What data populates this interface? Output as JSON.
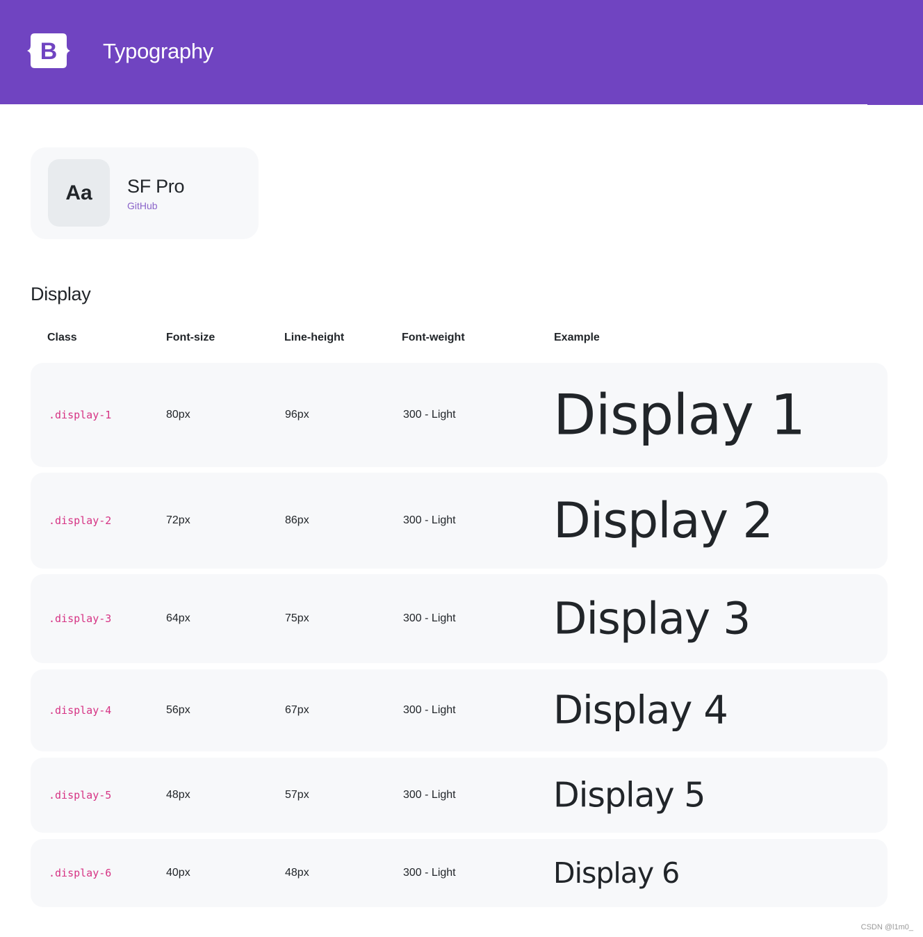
{
  "header": {
    "title": "Typography",
    "background_color": "#7044c1",
    "logo_icon": "bootstrap-logo-icon",
    "logo_letter": "B"
  },
  "font_card": {
    "swatch": "Aa",
    "name": "SF Pro",
    "link": "GitHub"
  },
  "section": {
    "title": "Display"
  },
  "table": {
    "headers": [
      "Class",
      "Font-size",
      "Line-height",
      "Font-weight",
      "Example"
    ],
    "rows": [
      {
        "class": ".display-1",
        "font_size": "80px",
        "line_height": "96px",
        "font_weight": "300 - Light",
        "example": "Display 1"
      },
      {
        "class": ".display-2",
        "font_size": "72px",
        "line_height": "86px",
        "font_weight": "300 - Light",
        "example": "Display 2"
      },
      {
        "class": ".display-3",
        "font_size": "64px",
        "line_height": "75px",
        "font_weight": "300 - Light",
        "example": "Display 3"
      },
      {
        "class": ".display-4",
        "font_size": "56px",
        "line_height": "67px",
        "font_weight": "300 - Light",
        "example": "Display 4"
      },
      {
        "class": ".display-5",
        "font_size": "48px",
        "line_height": "57px",
        "font_weight": "300 - Light",
        "example": "Display 5"
      },
      {
        "class": ".display-6",
        "font_size": "40px",
        "line_height": "48px",
        "font_weight": "300 - Light",
        "example": "Display 6"
      }
    ]
  },
  "watermark": "CSDN @l1m0_"
}
